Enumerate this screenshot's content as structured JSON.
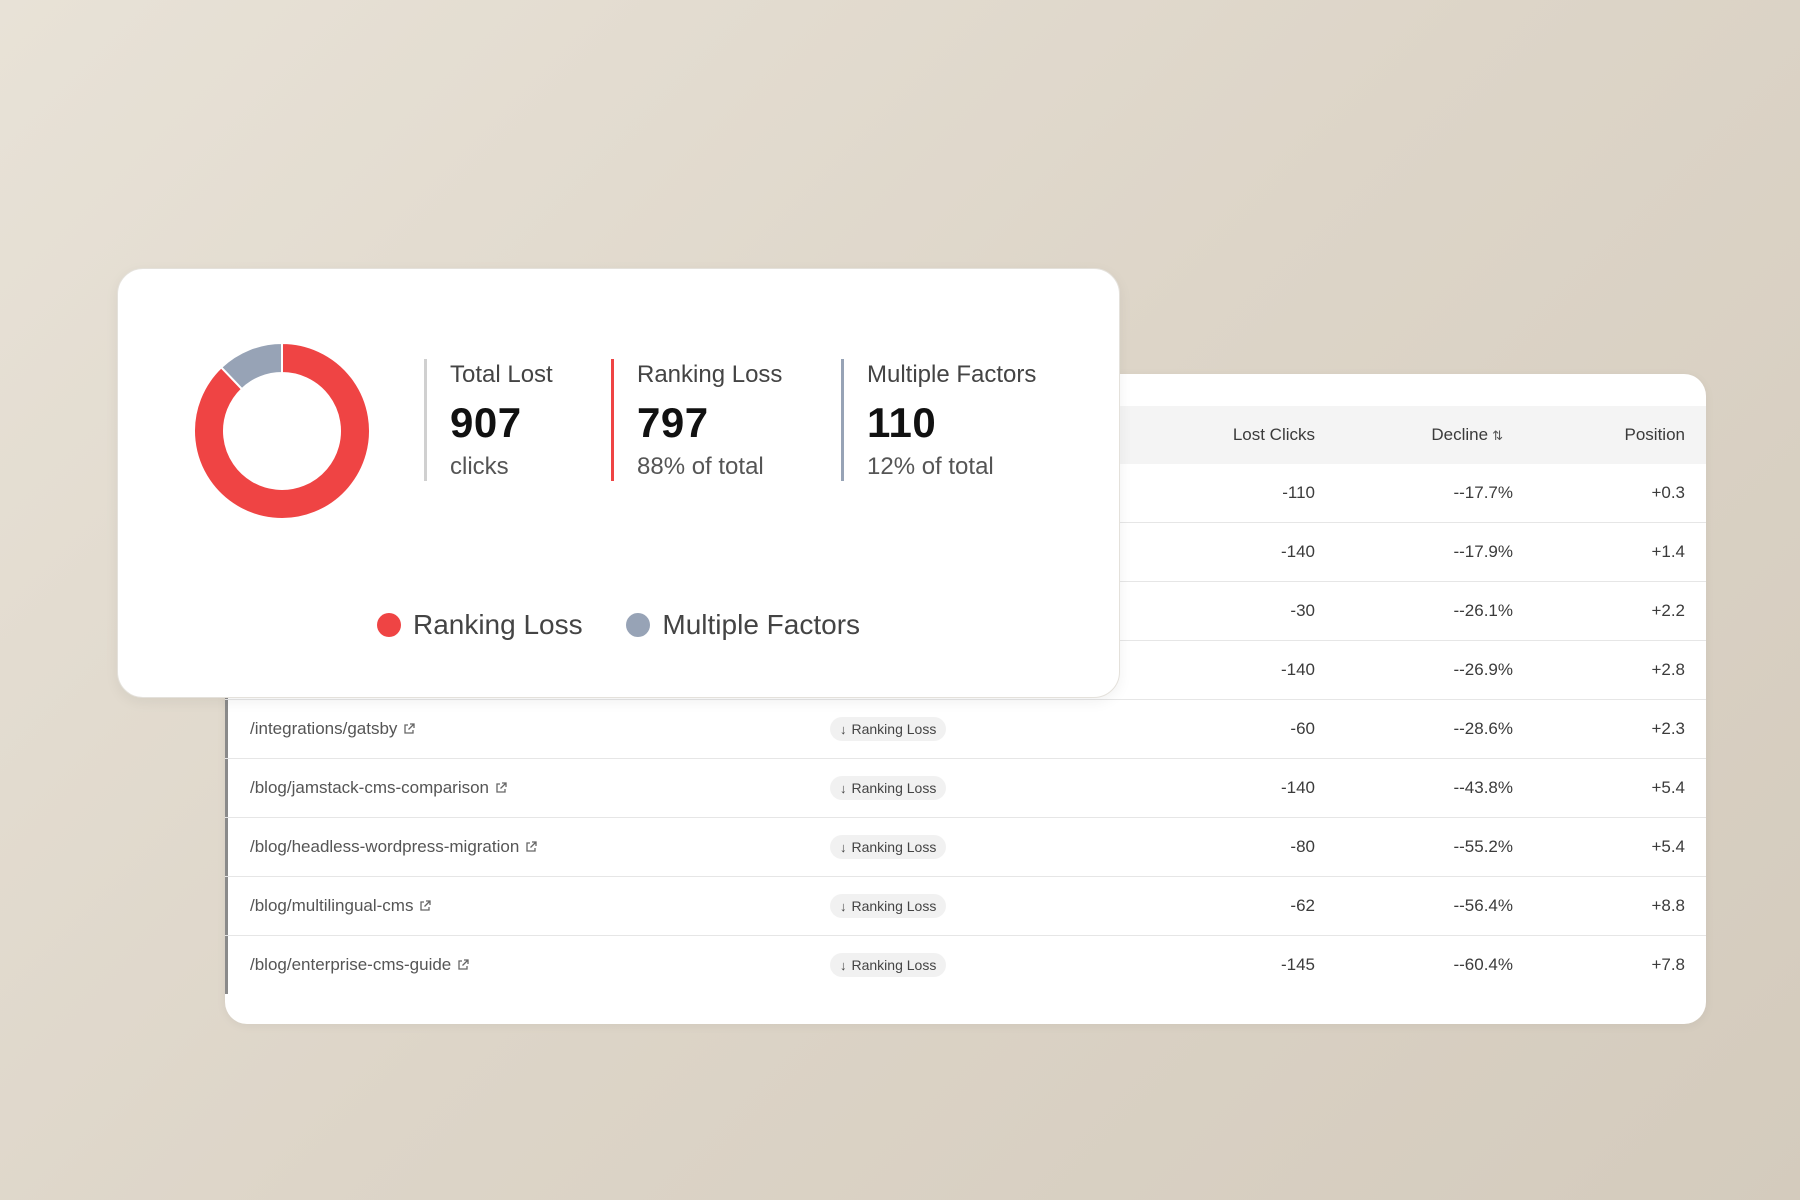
{
  "colors": {
    "ranking_loss": "#ef4444",
    "multiple_factors": "#97a3b6",
    "total_divider": "#d0d0d0"
  },
  "summary": {
    "total": {
      "label": "Total Lost",
      "value": "907",
      "sub": "clicks"
    },
    "ranking": {
      "label": "Ranking Loss",
      "value": "797",
      "sub": "88% of total"
    },
    "multiple": {
      "label": "Multiple Factors",
      "value": "110",
      "sub": "12% of total"
    },
    "legend": [
      {
        "label": "Ranking Loss"
      },
      {
        "label": "Multiple Factors"
      }
    ]
  },
  "chart_data": {
    "type": "pie",
    "categories": [
      "Ranking Loss",
      "Multiple Factors"
    ],
    "values": [
      797,
      110
    ]
  },
  "table": {
    "headers": {
      "lost_clicks": "Lost Clicks",
      "decline": "Decline",
      "position": "Position",
      "decline_sort_icon": "sort-icon"
    },
    "rows": [
      {
        "url": "",
        "badge": "",
        "lost": "-110",
        "decline": "--17.7%",
        "position": "+0.3"
      },
      {
        "url": "",
        "badge": "",
        "lost": "-140",
        "decline": "--17.9%",
        "position": "+1.4"
      },
      {
        "url": "",
        "badge": "",
        "lost": "-30",
        "decline": "--26.1%",
        "position": "+2.2"
      },
      {
        "url": "",
        "badge": "",
        "lost": "-140",
        "decline": "--26.9%",
        "position": "+2.8"
      },
      {
        "url": "/integrations/gatsby",
        "badge": "Ranking Loss",
        "lost": "-60",
        "decline": "--28.6%",
        "position": "+2.3"
      },
      {
        "url": "/blog/jamstack-cms-comparison",
        "badge": "Ranking Loss",
        "lost": "-140",
        "decline": "--43.8%",
        "position": "+5.4"
      },
      {
        "url": "/blog/headless-wordpress-migration",
        "badge": "Ranking Loss",
        "lost": "-80",
        "decline": "--55.2%",
        "position": "+5.4"
      },
      {
        "url": "/blog/multilingual-cms",
        "badge": "Ranking Loss",
        "lost": "-62",
        "decline": "--56.4%",
        "position": "+8.8"
      },
      {
        "url": "/blog/enterprise-cms-guide",
        "badge": "Ranking Loss",
        "lost": "-145",
        "decline": "--60.4%",
        "position": "+7.8"
      }
    ]
  }
}
